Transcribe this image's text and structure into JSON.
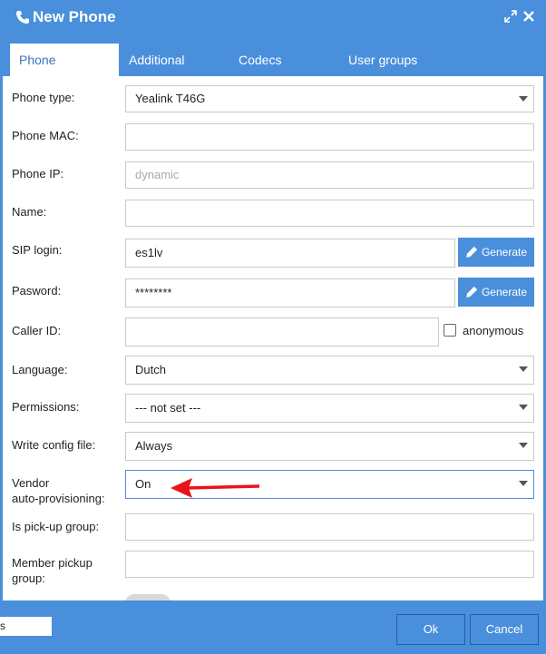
{
  "window": {
    "title": "New Phone",
    "icon": "phone-icon",
    "controls": [
      "expand-icon",
      "close-icon"
    ]
  },
  "tabs": [
    {
      "label": "Phone",
      "active": true
    },
    {
      "label": "Additional",
      "active": false
    },
    {
      "label": "Codecs",
      "active": false
    },
    {
      "label": "User groups",
      "active": false
    }
  ],
  "form": {
    "phone_type": {
      "label": "Phone type:",
      "value": "Yealink T46G"
    },
    "phone_mac": {
      "label": "Phone MAC:",
      "value": ""
    },
    "phone_ip": {
      "label": "Phone IP:",
      "placeholder": "dynamic"
    },
    "name": {
      "label": "Name:",
      "value": ""
    },
    "sip_login": {
      "label": "SIP login:",
      "value": "es1lv",
      "button": "Generate"
    },
    "password": {
      "label": "Pasword:",
      "value": "********",
      "button": "Generate"
    },
    "caller_id": {
      "label": "Caller ID:",
      "value": "",
      "checkbox_label": "anonymous",
      "checked": false
    },
    "language": {
      "label": "Language:",
      "value": "Dutch"
    },
    "permissions": {
      "label": "Permissions:",
      "value": "--- not set ---"
    },
    "write_config": {
      "label": "Write config file:",
      "value": "Always"
    },
    "vendor_autoprov": {
      "label_line1": "Vendor",
      "label_line2": "auto-provisioning:",
      "value": "On"
    },
    "pickup_group": {
      "label": "Is pick-up group:",
      "value": ""
    },
    "member_pickup": {
      "label_line1": "Member pickup",
      "label_line2": "group:",
      "value": ""
    }
  },
  "footer": {
    "ok": "Ok",
    "cancel": "Cancel"
  },
  "background_stub": "s",
  "colors": {
    "accent": "#4a8fdc",
    "annotation_arrow": "#e8141b"
  }
}
